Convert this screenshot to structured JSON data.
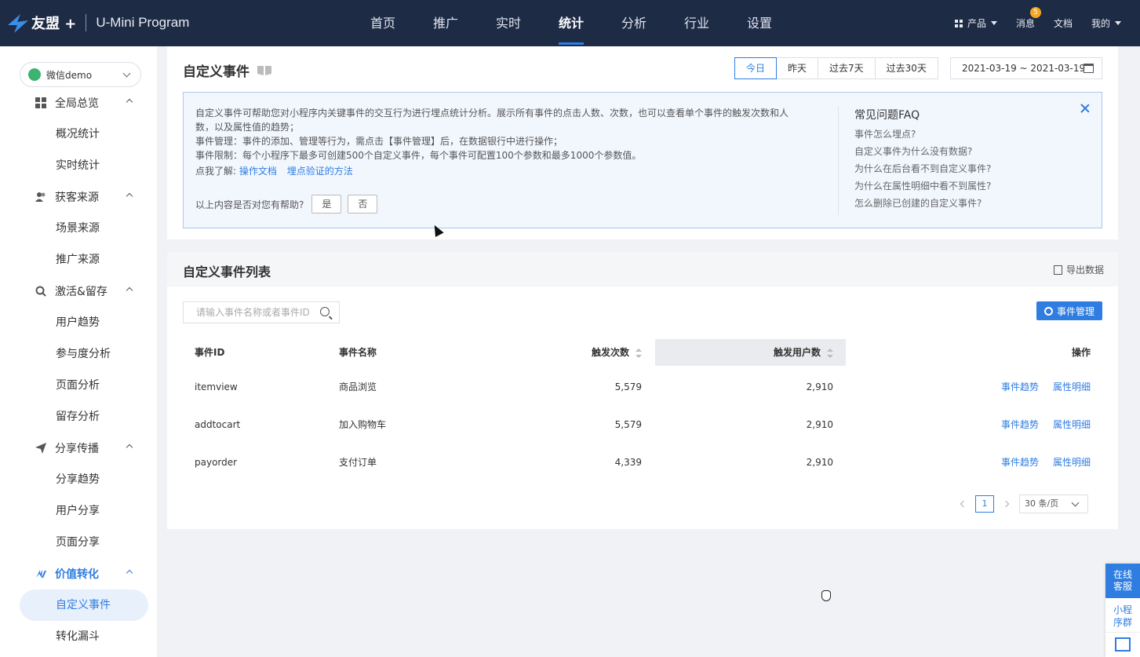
{
  "topbar": {
    "brand": "友盟 +",
    "product": "U-Mini Program",
    "nav": [
      "首页",
      "推广",
      "实时",
      "统计",
      "分析",
      "行业",
      "设置"
    ],
    "active_nav": "统计",
    "products_label": "产品",
    "messages_label": "消息",
    "messages_badge": "5",
    "docs_label": "文档",
    "mine_label": "我的"
  },
  "sidebar": {
    "app_name": "微信demo",
    "groups": [
      {
        "label": "全局总览",
        "items": [
          "概况统计",
          "实时统计"
        ]
      },
      {
        "label": "获客来源",
        "items": [
          "场景来源",
          "推广来源"
        ]
      },
      {
        "label": "激活&留存",
        "items": [
          "用户趋势",
          "参与度分析",
          "页面分析",
          "留存分析"
        ]
      },
      {
        "label": "分享传播",
        "items": [
          "分享趋势",
          "用户分享",
          "页面分享"
        ]
      },
      {
        "label": "价值转化",
        "items": [
          "自定义事件",
          "转化漏斗"
        ]
      }
    ],
    "active_item": "自定义事件"
  },
  "header": {
    "title": "自定义事件",
    "date_tabs": [
      "今日",
      "昨天",
      "过去7天",
      "过去30天"
    ],
    "active_tab": "今日",
    "date_range": "2021-03-19 ~ 2021-03-19"
  },
  "info": {
    "line1": "自定义事件可帮助您对小程序内关键事件的交互行为进行埋点统计分析。展示所有事件的点击人数、次数，也可以查看单个事件的触发次数和人数，以及属性值的趋势；",
    "line2": "事件管理：事件的添加、管理等行为，需点击【事件管理】后，在数据银行中进行操作；",
    "line3": "事件限制：每个小程序下最多可创建500个自定义事件，每个事件可配置100个参数和最多1000个参数值。",
    "learn_prefix": "点我了解:",
    "link1": "操作文档",
    "link2": "埋点验证的方法",
    "helpful_q": "以上内容是否对您有帮助?",
    "yes": "是",
    "no": "否"
  },
  "faq": {
    "title": "常见问题FAQ",
    "questions": [
      "事件怎么埋点?",
      "自定义事件为什么没有数据?",
      "为什么在后台看不到自定义事件?",
      "为什么在属性明细中看不到属性?",
      "怎么删除已创建的自定义事件?"
    ]
  },
  "list": {
    "title": "自定义事件列表",
    "export_label": "导出数据",
    "search_placeholder": "请输入事件名称或者事件ID",
    "manage_label": "事件管理",
    "columns": [
      "事件ID",
      "事件名称",
      "触发次数",
      "触发用户数",
      "操作"
    ],
    "rows": [
      {
        "id": "itemview",
        "name": "商品浏览",
        "count": "5,579",
        "users": "2,910"
      },
      {
        "id": "addtocart",
        "name": "加入购物车",
        "count": "5,579",
        "users": "2,910"
      },
      {
        "id": "payorder",
        "name": "支付订单",
        "count": "4,339",
        "users": "2,910"
      }
    ],
    "action_trend": "事件趋势",
    "action_detail": "属性明细",
    "page": "1",
    "page_size": "30 条/页"
  },
  "float_cs": {
    "online_line1": "在线",
    "online_line2": "客服",
    "group_line1": "小程",
    "group_line2": "序群"
  },
  "colors": {
    "accent": "#2f7de1",
    "topbar": "#1e2b45",
    "info_bg": "#f2f7fe"
  }
}
